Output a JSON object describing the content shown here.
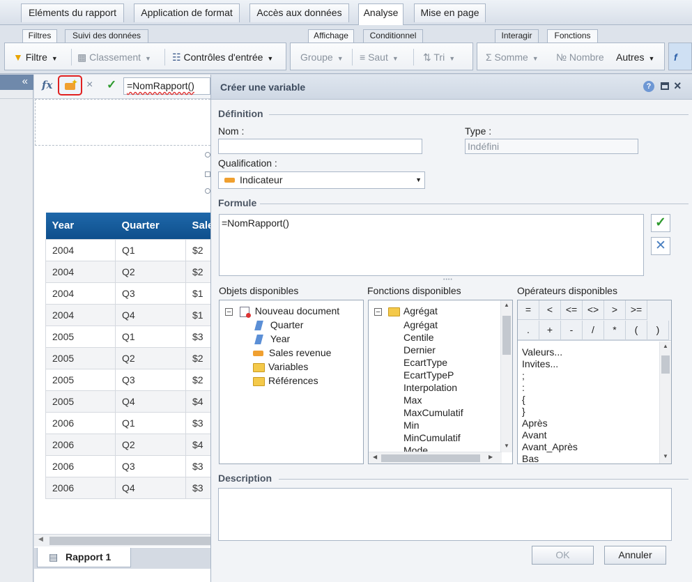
{
  "main_tabs": [
    "Eléments du rapport",
    "Application de format",
    "Accès aux données",
    "Analyse",
    "Mise en page"
  ],
  "sub_tabs": {
    "left": [
      "Filtres",
      "Suivi des données"
    ],
    "middle": [
      "Affichage",
      "Conditionnel"
    ],
    "right": [
      "Interagir",
      "Fonctions"
    ]
  },
  "ribbon": {
    "filtre": "Filtre",
    "classement": "Classement",
    "controles": "Contrôles d'entrée",
    "groupe": "Groupe",
    "saut": "Saut",
    "tri": "Tri",
    "somme": "Somme",
    "nombre": "Nombre",
    "autres": "Autres"
  },
  "formula_bar": {
    "value": "=NomRapport()"
  },
  "table": {
    "headers": [
      "Year",
      "Quarter",
      "Sale"
    ],
    "rows": [
      [
        "2004",
        "Q1",
        "$2"
      ],
      [
        "2004",
        "Q2",
        "$2"
      ],
      [
        "2004",
        "Q3",
        "$1"
      ],
      [
        "2004",
        "Q4",
        "$1"
      ],
      [
        "2005",
        "Q1",
        "$3"
      ],
      [
        "2005",
        "Q2",
        "$2"
      ],
      [
        "2005",
        "Q3",
        "$2"
      ],
      [
        "2005",
        "Q4",
        "$4"
      ],
      [
        "2006",
        "Q1",
        "$3"
      ],
      [
        "2006",
        "Q2",
        "$4"
      ],
      [
        "2006",
        "Q3",
        "$3"
      ],
      [
        "2006",
        "Q4",
        "$3"
      ]
    ]
  },
  "report_tab": "Rapport 1",
  "dialog": {
    "title": "Créer une variable",
    "definition": "Définition",
    "name_label": "Nom :",
    "name_value": "",
    "type_label": "Type :",
    "type_value": "Indéfini",
    "qualification_label": "Qualification :",
    "qualification_value": "Indicateur",
    "formule_label": "Formule",
    "formule_value": "=NomRapport()",
    "objets_label": "Objets disponibles",
    "fonctions_label": "Fonctions disponibles",
    "operateurs_label": "Opérateurs disponibles",
    "objets": {
      "root": "Nouveau document",
      "items": [
        "Quarter",
        "Year",
        "Sales revenue",
        "Variables",
        "Références"
      ]
    },
    "fonctions": {
      "root": "Agrégat",
      "items": [
        "Agrégat",
        "Centile",
        "Dernier",
        "EcartType",
        "EcartTypeP",
        "Interpolation",
        "Max",
        "MaxCumulatif",
        "Min",
        "MinCumulatif",
        "Mode"
      ]
    },
    "operators_row1": [
      "=",
      "<",
      "<=",
      "<>",
      ">",
      ">="
    ],
    "operators_row2": [
      ".",
      "+",
      "-",
      "/",
      "*",
      "(",
      ")"
    ],
    "operators_list": [
      "Valeurs...",
      "Invites...",
      ";",
      ":",
      "{",
      "}",
      "Après",
      "Avant",
      "Avant_Après",
      "Bas"
    ],
    "description_label": "Description",
    "ok": "OK",
    "annuler": "Annuler"
  }
}
